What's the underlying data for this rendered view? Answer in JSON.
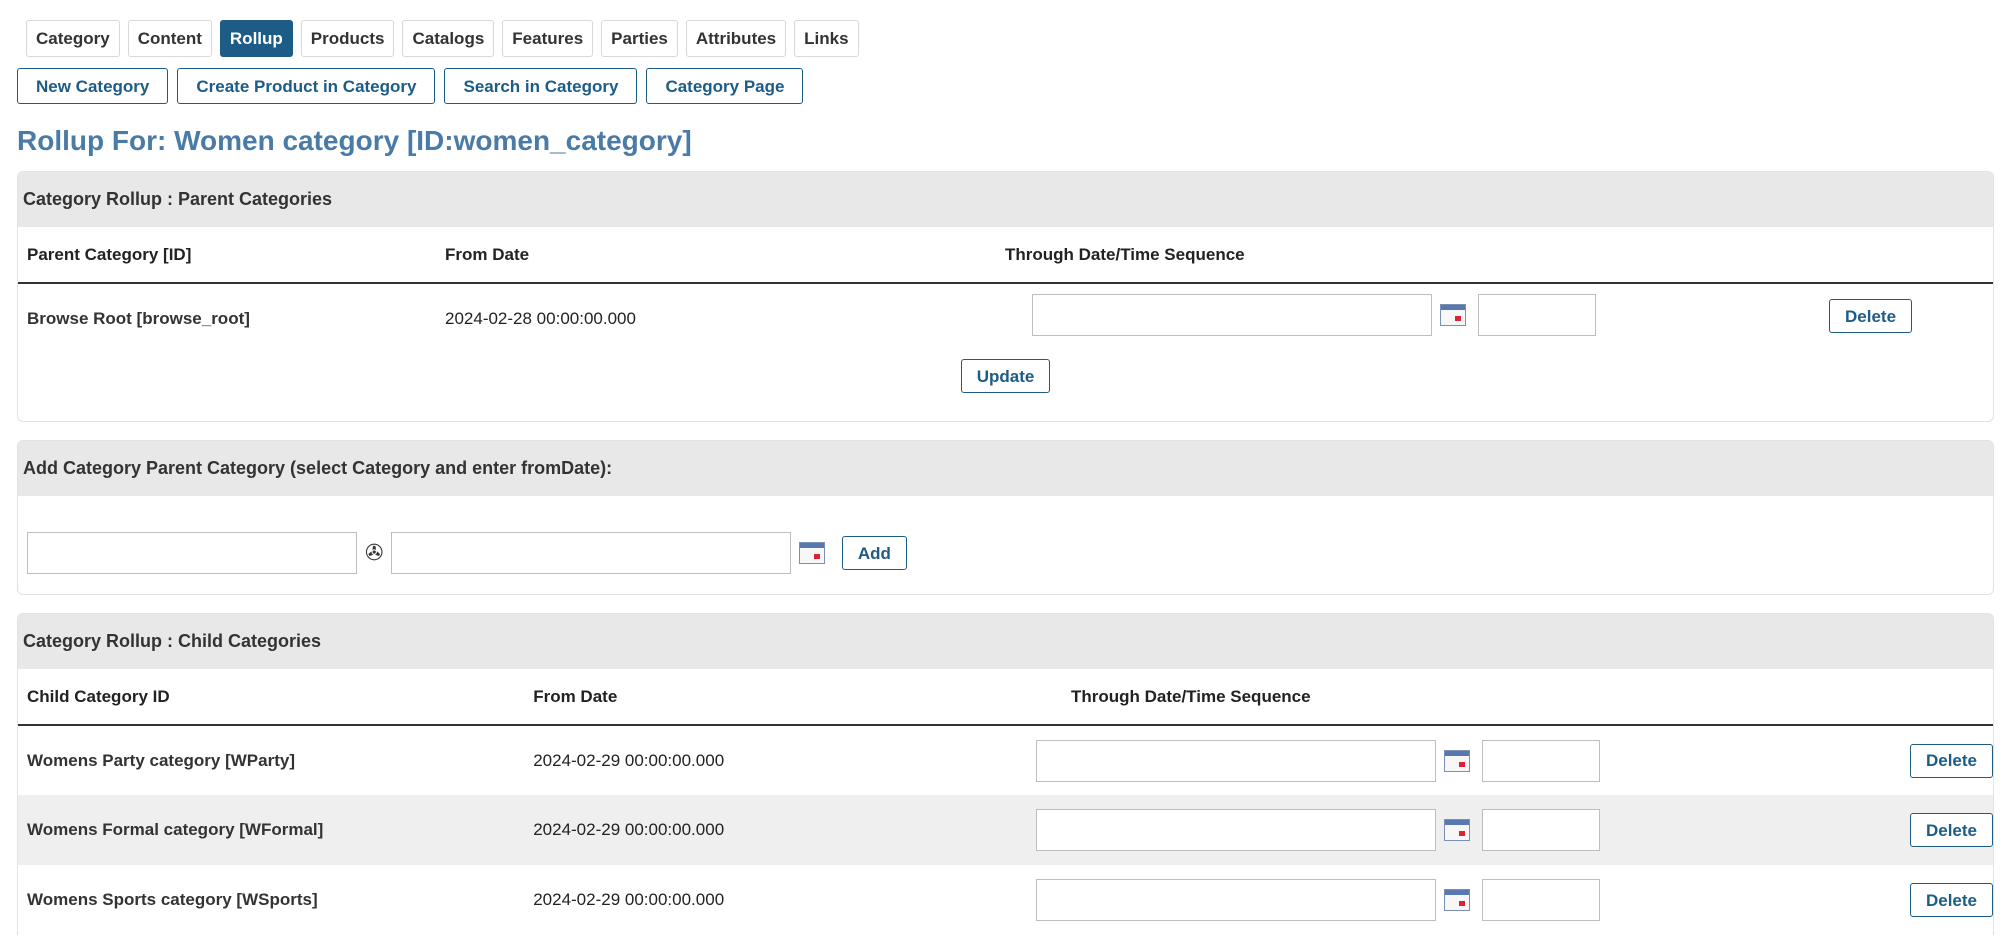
{
  "tabs": [
    {
      "label": "Category",
      "active": false
    },
    {
      "label": "Content",
      "active": false
    },
    {
      "label": "Rollup",
      "active": true
    },
    {
      "label": "Products",
      "active": false
    },
    {
      "label": "Catalogs",
      "active": false
    },
    {
      "label": "Features",
      "active": false
    },
    {
      "label": "Parties",
      "active": false
    },
    {
      "label": "Attributes",
      "active": false
    },
    {
      "label": "Links",
      "active": false
    }
  ],
  "actions": {
    "new_category": "New Category",
    "create_product": "Create Product in Category",
    "search_in_category": "Search in Category",
    "category_page": "Category Page"
  },
  "page_title": "Rollup For: Women category [ID:women_category]",
  "parents": {
    "title": "Category Rollup : Parent Categories",
    "headers": {
      "category": "Parent Category [ID]",
      "from_date": "From Date",
      "through": "Through Date/Time Sequence"
    },
    "rows": [
      {
        "name": "Browse Root [browse_root]",
        "from_date": "2024-02-28 00:00:00.000",
        "delete": "Delete"
      }
    ],
    "update": "Update"
  },
  "add_parent": {
    "title": "Add Category Parent Category (select Category and enter fromDate):",
    "add": "Add"
  },
  "children": {
    "title": "Category Rollup : Child Categories",
    "headers": {
      "category": "Child Category ID",
      "from_date": "From Date",
      "through": "Through Date/Time Sequence"
    },
    "rows": [
      {
        "name": "Womens Party category [WParty]",
        "from_date": "2024-02-29 00:00:00.000",
        "delete": "Delete"
      },
      {
        "name": "Womens Formal category [WFormal]",
        "from_date": "2024-02-29 00:00:00.000",
        "delete": "Delete"
      },
      {
        "name": "Womens Sports category [WSports]",
        "from_date": "2024-02-29 00:00:00.000",
        "delete": "Delete"
      }
    ]
  },
  "icons": {
    "calendar": "calendar-icon",
    "lookup": "lookup-icon"
  },
  "colors": {
    "accent": "#1c5c86",
    "title": "#4a7ba7",
    "section_header": "#e8e8e8"
  }
}
